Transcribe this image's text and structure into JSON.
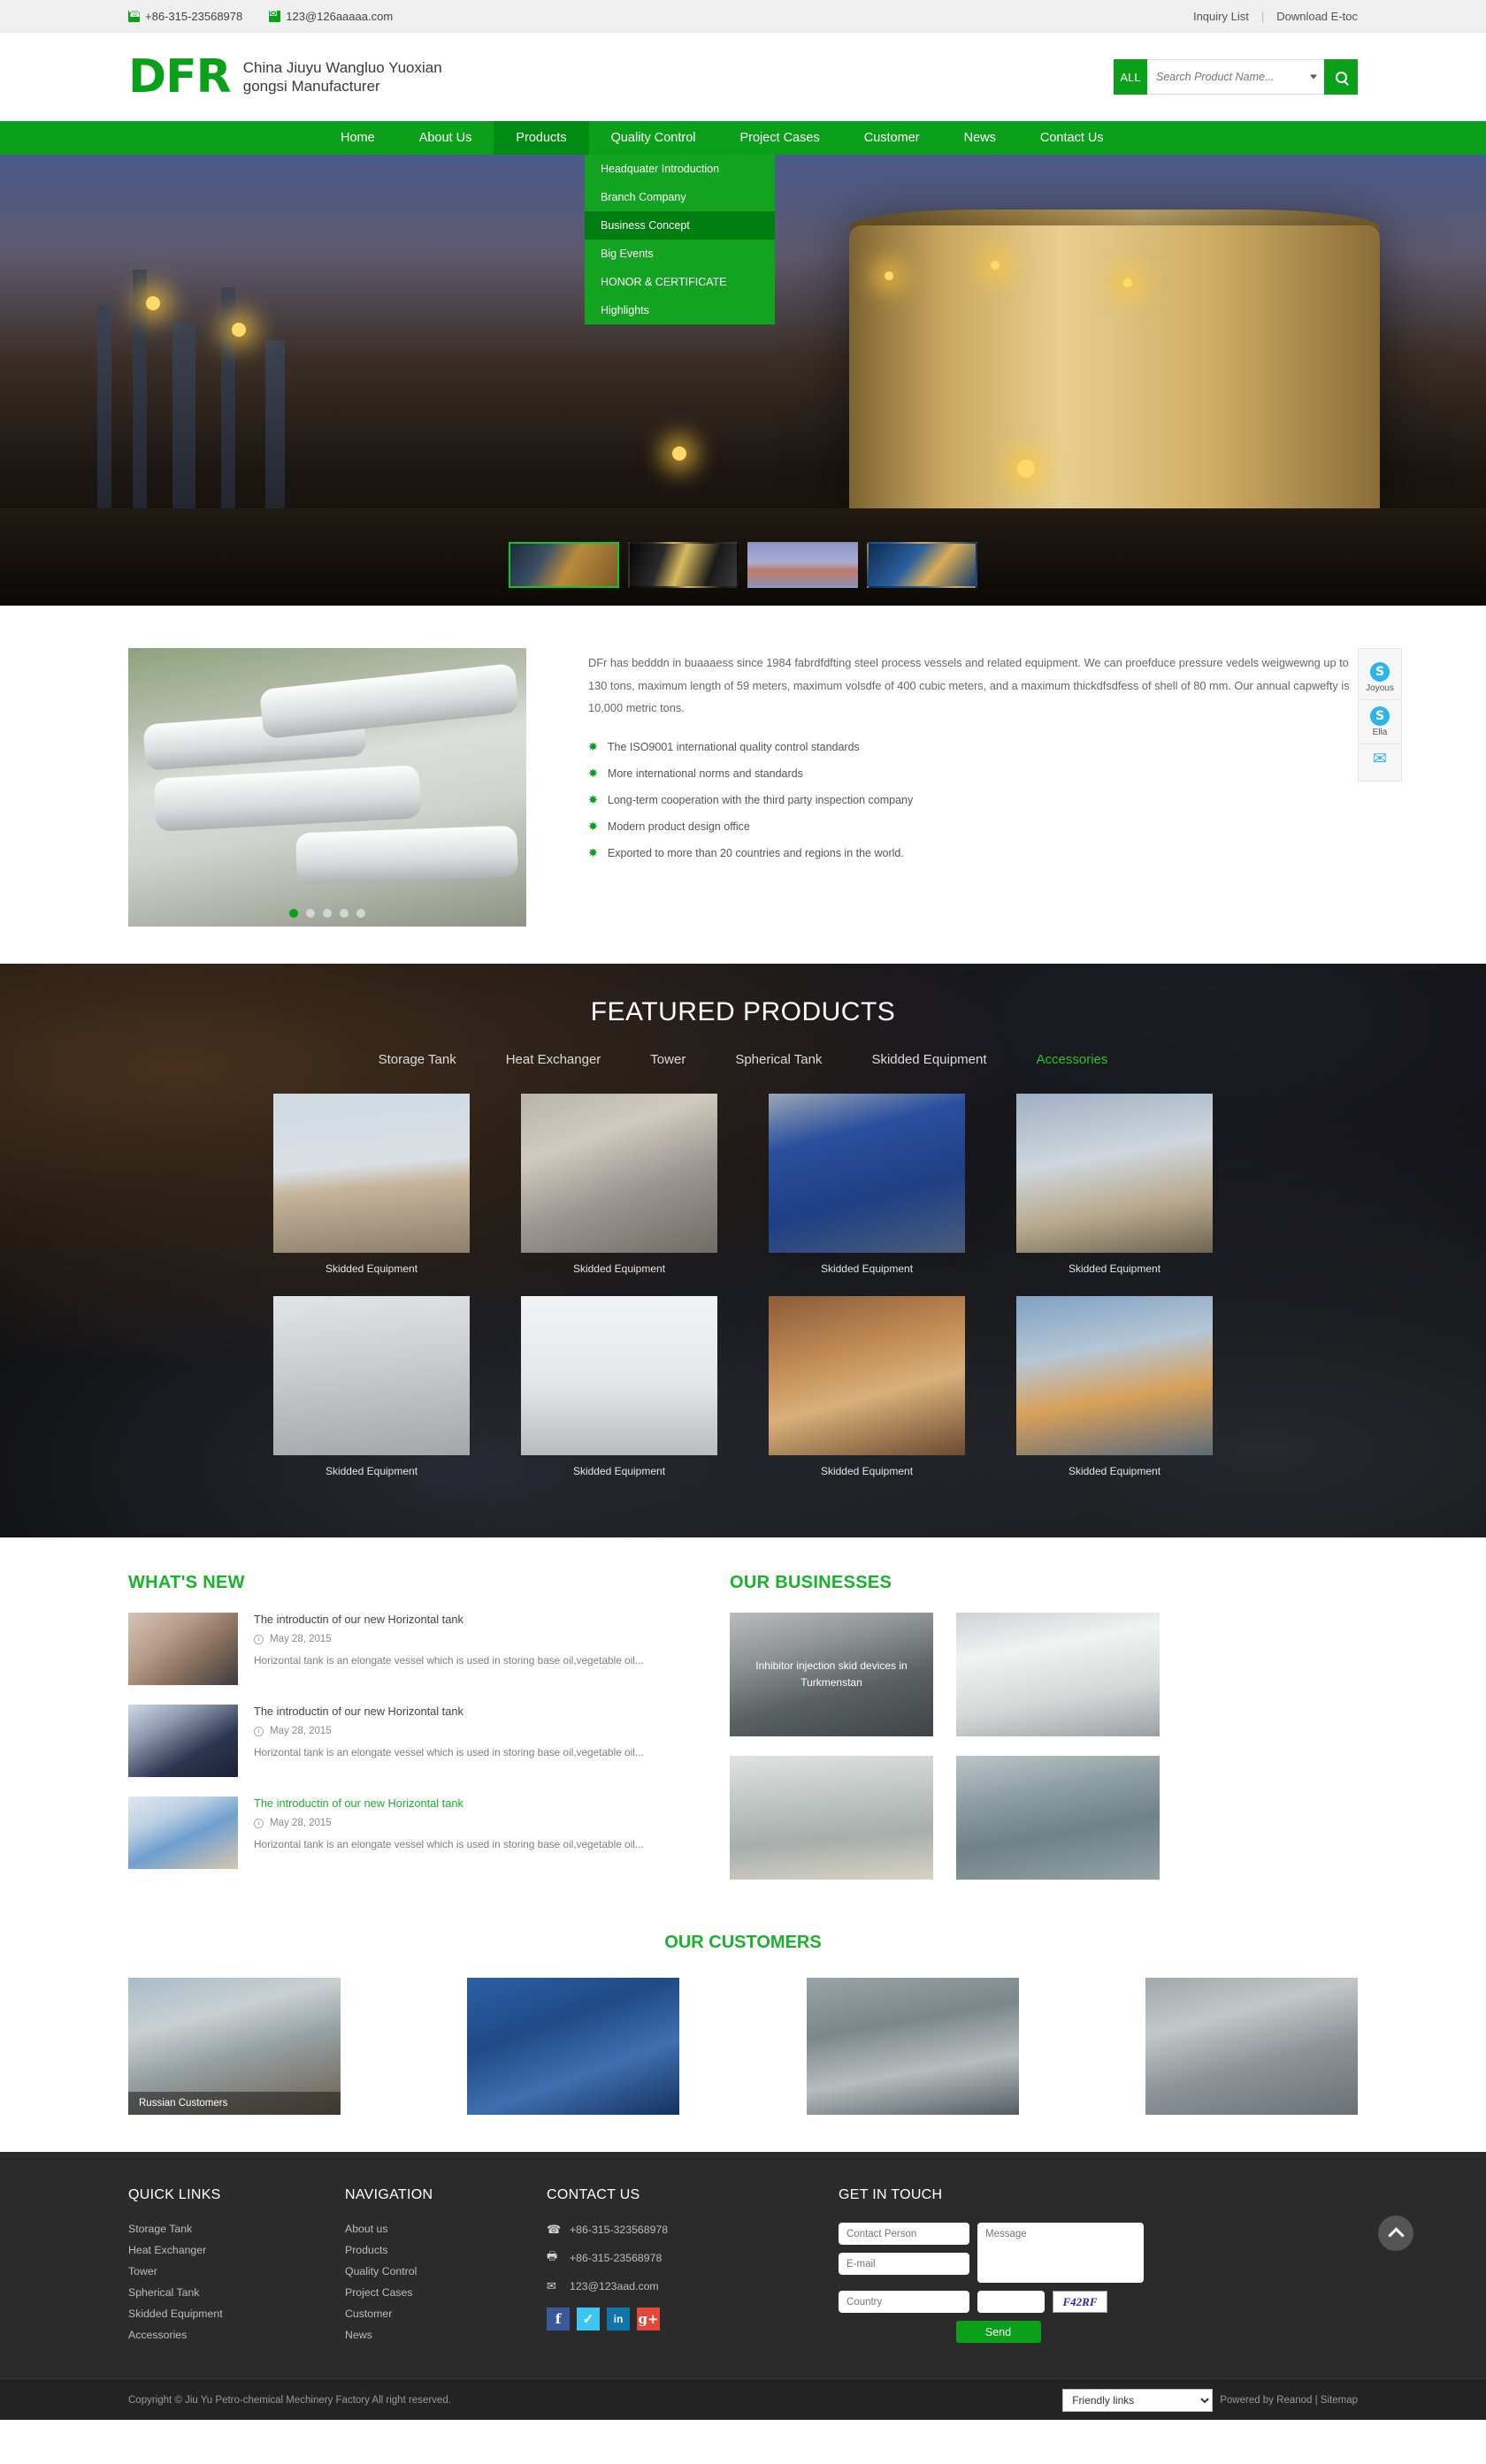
{
  "topbar": {
    "phone": "+86-315-23568978",
    "email": "123@126aaaaa.com",
    "inquiry_list": "Inquiry List",
    "separator": "|",
    "download_etoc": "Download E-toc"
  },
  "header": {
    "logo": "DFR",
    "tagline": "China Jiuyu Wangluo Yuoxian gongsi Manufacturer",
    "search": {
      "all_label": "ALL",
      "placeholder": "Search Product Name..."
    }
  },
  "nav": {
    "items": [
      {
        "label": "Home",
        "active": false
      },
      {
        "label": "About Us",
        "active": false
      },
      {
        "label": "Products",
        "active": true
      },
      {
        "label": "Quality Control",
        "active": false
      },
      {
        "label": "Project Cases",
        "active": false
      },
      {
        "label": "Customer",
        "active": false
      },
      {
        "label": "News",
        "active": false
      },
      {
        "label": "Contact Us",
        "active": false
      }
    ],
    "dropdown": [
      {
        "label": "Headquater Introduction",
        "active": false
      },
      {
        "label": "Branch Company",
        "active": false
      },
      {
        "label": "Business Concept",
        "active": true
      },
      {
        "label": "Big Events",
        "active": false
      },
      {
        "label": "HONOR & CERTIFICATE",
        "active": false
      },
      {
        "label": "Highlights",
        "active": false
      }
    ]
  },
  "about": {
    "paragraph": "DFr has bedddn in buaaaess since 1984 fabrdfdfting steel process vessels and related equipment. We can proefduce pressure vedels weigwewng up to 130 tons, maximum length of 59 meters, maximum volsdfe of 400 cubic meters, and a maximum thickdfsdfess of shell of 80 mm. Our annual capwefty is 10,000 metric tons.",
    "bullets": [
      "The ISO9001 international quality control standards",
      "More international norms and standards",
      "Long-term cooperation with the third party inspection company",
      "Modern product design office",
      "Exported to more than 20 countries and regions in the world."
    ]
  },
  "sidechat": {
    "items": [
      {
        "type": "skype",
        "glyph": "S",
        "name": "Joyous"
      },
      {
        "type": "skype",
        "glyph": "S",
        "name": "Ella"
      },
      {
        "type": "mail",
        "glyph": "✉",
        "name": ""
      }
    ]
  },
  "featured": {
    "title": "FEATURED PRODUCTS",
    "tabs": [
      {
        "label": "Storage Tank",
        "active": false
      },
      {
        "label": "Heat Exchanger",
        "active": false
      },
      {
        "label": "Tower",
        "active": false
      },
      {
        "label": "Spherical Tank",
        "active": false
      },
      {
        "label": "Skidded Equipment",
        "active": false
      },
      {
        "label": "Accessories",
        "active": true
      }
    ],
    "products": [
      {
        "label": "Skidded Equipment"
      },
      {
        "label": "Skidded Equipment"
      },
      {
        "label": "Skidded Equipment"
      },
      {
        "label": "Skidded Equipment"
      },
      {
        "label": "Skidded Equipment"
      },
      {
        "label": "Skidded Equipment"
      },
      {
        "label": "Skidded Equipment"
      },
      {
        "label": "Skidded Equipment"
      }
    ]
  },
  "news": {
    "heading": "WHAT'S NEW",
    "items": [
      {
        "title": "The introductin of our new Horizontal tank",
        "date": "May 28, 2015",
        "desc": "Horizontal tank is an elongate vessel which is used in storing base oil,vegetable oil...",
        "highlight": false
      },
      {
        "title": "The introductin of our new Horizontal tank",
        "date": "May 28, 2015",
        "desc": "Horizontal tank is an elongate vessel which is used in storing base oil,vegetable oil...",
        "highlight": false
      },
      {
        "title": "The introductin of our new Horizontal tank",
        "date": "May 28, 2015",
        "desc": "Horizontal tank is an elongate vessel which is used in storing base oil,vegetable oil...",
        "highlight": true
      }
    ]
  },
  "businesses": {
    "heading": "OUR BUSINESSES",
    "cards": [
      {
        "caption": "Inhibitor injection skid devices in Turkmenstan"
      },
      {
        "caption": ""
      },
      {
        "caption": ""
      },
      {
        "caption": ""
      }
    ]
  },
  "customers": {
    "heading": "OUR CUSTOMERS",
    "cards": [
      {
        "caption": "Russian Customers"
      },
      {
        "caption": ""
      },
      {
        "caption": ""
      },
      {
        "caption": ""
      }
    ]
  },
  "footer": {
    "quick_links": {
      "heading": "QUICK LINKS",
      "items": [
        "Storage Tank",
        "Heat Exchanger",
        "Tower",
        "Spherical Tank",
        "Skidded Equipment",
        "Accessories"
      ]
    },
    "navigation": {
      "heading": "NAVIGATION",
      "items": [
        "About us",
        "Products",
        "Quality Control",
        "Project Cases",
        "Customer",
        "News"
      ]
    },
    "contact": {
      "heading": "CONTACT US",
      "phone": "+86-315-323568978",
      "fax": "+86-315-23568978",
      "email": "123@123aad.com",
      "socials": [
        {
          "name": "facebook",
          "glyph": "f"
        },
        {
          "name": "twitter",
          "glyph": "✓"
        },
        {
          "name": "linkedin",
          "glyph": "in"
        },
        {
          "name": "googleplus",
          "glyph": "g+"
        }
      ]
    },
    "get_in_touch": {
      "heading": "GET IN TOUCH",
      "contact_person_placeholder": "Contact Person",
      "email_placeholder": "E-mail",
      "country_placeholder": "Country",
      "message_placeholder": "Message",
      "code_placeholder": "",
      "captcha_text": "F42RF",
      "send_label": "Send"
    }
  },
  "copyright": {
    "text": "Copyright © Jiu Yu Petro-chemical Mechinery Factory All right reserved.",
    "friendly_links": "Friendly links",
    "powered": "Powered by Reanod | Sitemap"
  },
  "colors": {
    "brand_green": "#0aa01a",
    "accent_green": "#17b32a",
    "dark_footer": "#2b2b2b"
  }
}
